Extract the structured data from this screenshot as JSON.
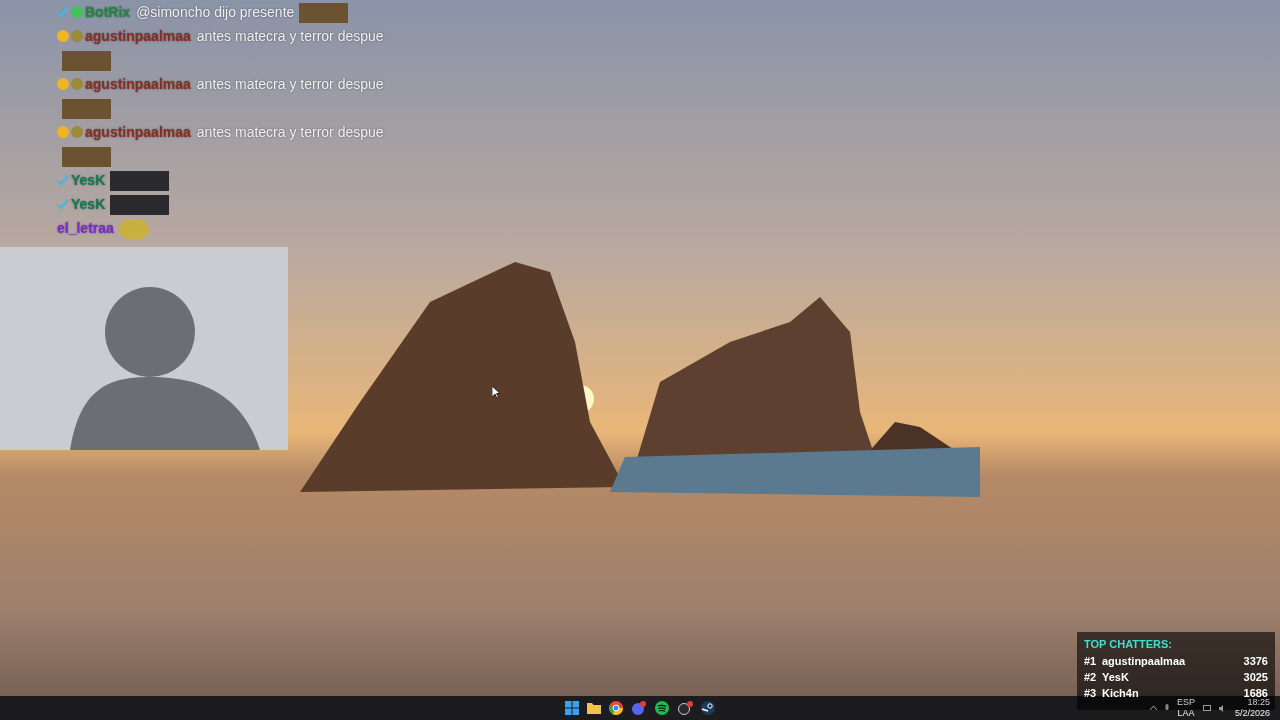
{
  "chat": {
    "messages": [
      {
        "username": "BotRix",
        "color": "#1f8a3a",
        "text": "@simoncho dijo presente",
        "badges": [
          {
            "kind": "verified"
          },
          {
            "kind": "emoji"
          }
        ]
      },
      {
        "username": "agustinpaalmaa",
        "color": "#8a2f1f",
        "text": "antes matecra y terror despue",
        "badges": [
          {
            "kind": "sub"
          },
          {
            "kind": "coin"
          }
        ]
      },
      {
        "username": "agustinpaalmaa",
        "color": "#8a2f1f",
        "text": "antes matecra y terror despue",
        "badges": [
          {
            "kind": "sub"
          },
          {
            "kind": "coin"
          }
        ]
      },
      {
        "username": "agustinpaalmaa",
        "color": "#8a2f1f",
        "text": "antes matecra y terror despue",
        "badges": [
          {
            "kind": "sub"
          },
          {
            "kind": "coin"
          }
        ]
      },
      {
        "username": "YesK",
        "color": "#0f7a52",
        "badges": [
          {
            "kind": "verified"
          }
        ]
      },
      {
        "username": "YesK",
        "color": "#0f7a52",
        "badges": [
          {
            "kind": "verified"
          }
        ]
      },
      {
        "username": "el_letraa",
        "color": "#7a2ad0"
      }
    ]
  },
  "top_chatters": {
    "title": "TOP CHATTERS:",
    "rows": [
      {
        "rank": "#1",
        "name": "agustinpaalmaa",
        "count": "3376"
      },
      {
        "rank": "#2",
        "name": "YesK",
        "count": "3025"
      },
      {
        "rank": "#3",
        "name": "Kich4n",
        "count": "1686"
      }
    ]
  },
  "tray": {
    "language": "ESP",
    "layout": "LAA",
    "time": "18:25",
    "date": "5/2/2026"
  }
}
